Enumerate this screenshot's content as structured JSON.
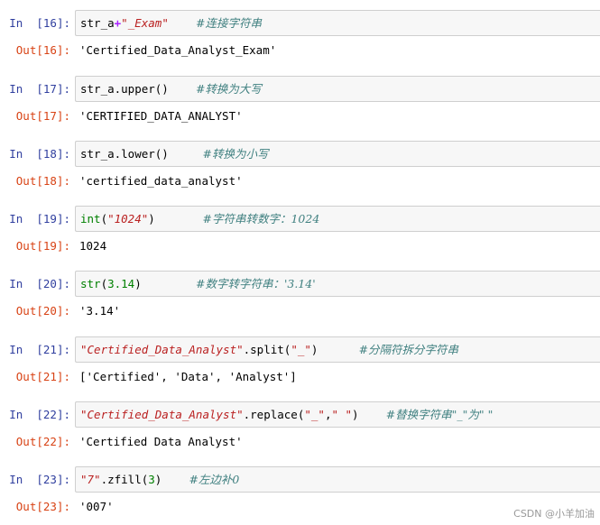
{
  "cells": [
    {
      "in_prompt": "In  [16]:",
      "out_prompt": "Out[16]:",
      "code": {
        "a": "str_a",
        "b": "+",
        "c": "\"_Exam\"",
        "gap": "    ",
        "comment": "#连接字符串"
      },
      "output": "'Certified_Data_Analyst_Exam'"
    },
    {
      "in_prompt": "In  [17]:",
      "out_prompt": "Out[17]:",
      "code": {
        "a": "str_a.upper()",
        "gap": "    ",
        "comment": "#转换为大写"
      },
      "output": "'CERTIFIED_DATA_ANALYST'"
    },
    {
      "in_prompt": "In  [18]:",
      "out_prompt": "Out[18]:",
      "code": {
        "a": "str_a.lower()",
        "gap": "     ",
        "comment": "#转换为小写"
      },
      "output": "'certified_data_analyst'"
    },
    {
      "in_prompt": "In  [19]:",
      "out_prompt": "Out[19]:",
      "code": {
        "fn": "int",
        "open": "(",
        "arg": "\"1024\"",
        "close": ")",
        "gap": "       ",
        "comment": "#字符串转数字：1024"
      },
      "output": "1024"
    },
    {
      "in_prompt": "In  [20]:",
      "out_prompt": "Out[20]:",
      "code": {
        "fn": "str",
        "open": "(",
        "arg": "3.14",
        "close": ")",
        "gap": "        ",
        "comment": "#数字转字符串：'3.14'"
      },
      "output": "'3.14'"
    },
    {
      "in_prompt": "In  [21]:",
      "out_prompt": "Out[21]:",
      "code": {
        "s": "\"Certified_Data_Analyst\"",
        "m": ".split(",
        "arg": "\"_\"",
        "close": ")",
        "gap": "      ",
        "comment": "#分隔符拆分字符串"
      },
      "output": "['Certified', 'Data', 'Analyst']"
    },
    {
      "in_prompt": "In  [22]:",
      "out_prompt": "Out[22]:",
      "code": {
        "s": "\"Certified_Data_Analyst\"",
        "m": ".replace(",
        "arg1": "\"_\"",
        "comma": ",",
        "arg2": "\" \"",
        "close": ")",
        "gap": "    ",
        "comment": "#替换字符串\"_\"为\" \""
      },
      "output": "'Certified Data Analyst'"
    },
    {
      "in_prompt": "In  [23]:",
      "out_prompt": "Out[23]:",
      "code": {
        "s": "\"7\"",
        "m": ".zfill(",
        "arg": "3",
        "close": ")",
        "gap": "    ",
        "comment": "#左边补0"
      },
      "output": "'007'"
    }
  ],
  "watermark": "CSDN @小羊加油"
}
